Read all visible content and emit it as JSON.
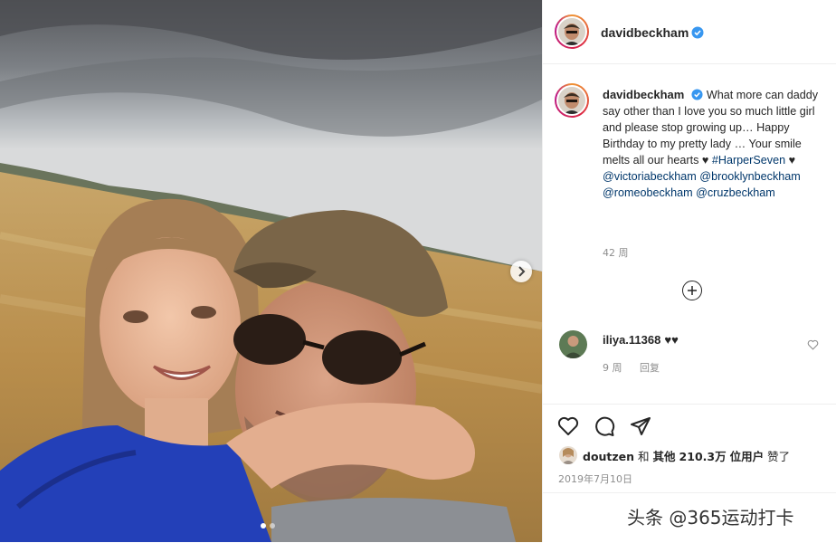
{
  "post": {
    "author": "davidbeckham",
    "verified": true,
    "caption_pre": "What more can daddy say other than I love you so much little girl and please stop growing up… Happy Birthday to my pretty lady … Your smile melts all our hearts ",
    "heart_glyph": "♥",
    "hashtag": "#HarperSeven",
    "mentions": [
      "@victoriabeckham",
      "@brooklynbeckham",
      "@romeobeckham",
      "@cruzbeckham"
    ],
    "caption_time": "42 周",
    "date": "2019年7月10日",
    "photo_icon": "chevron-right-icon"
  },
  "comment": {
    "user": "iliya.11368",
    "text": "♥♥",
    "time": "9 周",
    "reply_label": "回复"
  },
  "likes": {
    "user": "doutzen",
    "connector": "和",
    "others_label": "其他",
    "count": "210.3万",
    "suffix": "位用户",
    "verb": "赞了"
  },
  "watermark": "头条 @365运动打卡",
  "colors": {
    "text": "#262626",
    "muted": "#8e8e8e",
    "link": "#00376b",
    "verified": "#3897f0",
    "divider": "#efefef"
  }
}
